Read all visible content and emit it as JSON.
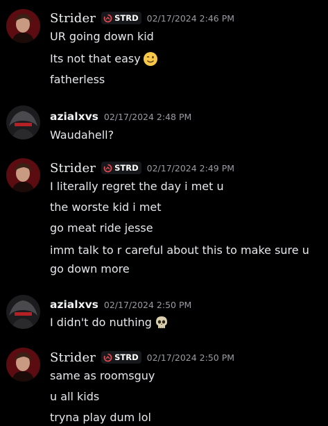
{
  "messages": [
    {
      "author": "Strider",
      "tag": "STRD",
      "timestamp": "02/17/2024 2:46 PM",
      "lines": [
        "UR going down kid",
        "Its not that easy",
        "fatherless"
      ],
      "emoji": "winking-face-emoji"
    },
    {
      "author": "azialxvs",
      "timestamp": "02/17/2024 2:48 PM",
      "lines": [
        "Waudahell?"
      ]
    },
    {
      "author": "Strider",
      "tag": "STRD",
      "timestamp": "02/17/2024 2:49 PM",
      "lines": [
        "I literally regret the day i met u",
        "the worste kid i met",
        "go meat ride jesse",
        "imm talk to r careful about this to make sure u",
        "go down more"
      ]
    },
    {
      "author": "azialxvs",
      "timestamp": "02/17/2024 2:50 PM",
      "lines": [
        "I didn't do nuthing"
      ],
      "emoji": "skull-emoji"
    },
    {
      "author": "Strider",
      "tag": "STRD",
      "timestamp": "02/17/2024 2:50 PM",
      "lines": [
        "same as roomsguy",
        "u all kids",
        "tryna play dum lol"
      ]
    }
  ],
  "colors": {
    "background": "#000000",
    "text": "#e6e8eb",
    "timestamp": "#9a9ca3",
    "tag_background": "#17181b",
    "tag_icon": "#e0484f"
  }
}
